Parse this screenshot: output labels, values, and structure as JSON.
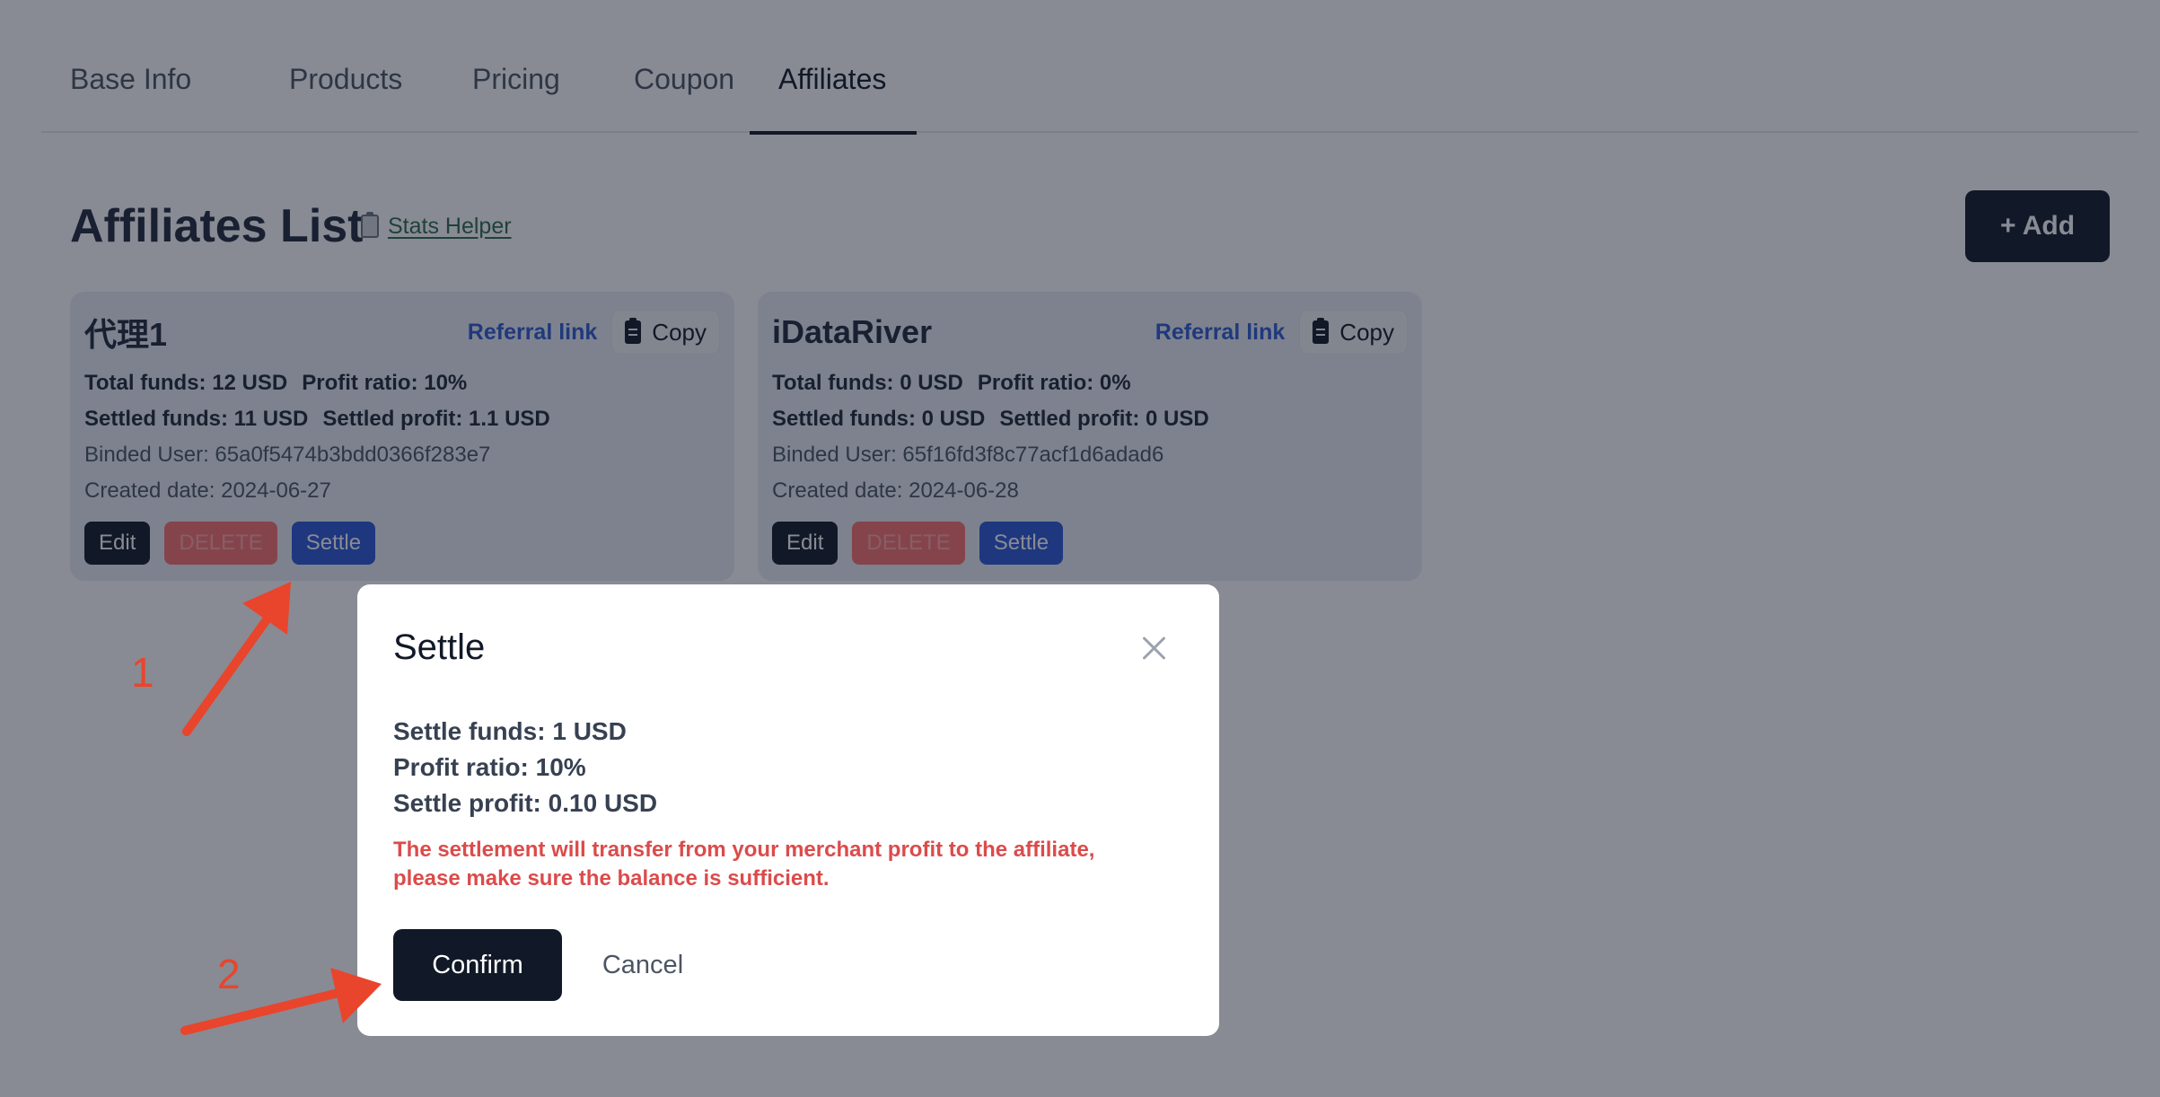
{
  "tabs": [
    {
      "label": "Base Info",
      "active": false
    },
    {
      "label": "Products",
      "active": false
    },
    {
      "label": "Pricing",
      "active": false
    },
    {
      "label": "Coupon",
      "active": false
    },
    {
      "label": "Affiliates",
      "active": true
    }
  ],
  "header": {
    "title": "Affiliates List",
    "stats_helper_icon": "clipboard-icon",
    "stats_helper_label": "Stats Helper",
    "add_button_label": "+ Add"
  },
  "affiliates": [
    {
      "name": "代理1",
      "referral_link_label": "Referral link",
      "copy_label": "Copy",
      "total_funds": "Total funds: 12 USD",
      "profit_ratio": "Profit ratio: 10%",
      "settled_funds": "Settled funds: 11 USD",
      "settled_profit": "Settled profit: 1.1 USD",
      "binded_user": "Binded User: 65a0f5474b3bdd0366f283e7",
      "created_date": "Created date: 2024-06-27",
      "edit_label": "Edit",
      "delete_label": "DELETE",
      "settle_label": "Settle"
    },
    {
      "name": "iDataRiver",
      "referral_link_label": "Referral link",
      "copy_label": "Copy",
      "total_funds": "Total funds: 0 USD",
      "profit_ratio": "Profit ratio: 0%",
      "settled_funds": "Settled funds: 0 USD",
      "settled_profit": "Settled profit: 0 USD",
      "binded_user": "Binded User: 65f16fd3f8c77acf1d6adad6",
      "created_date": "Created date: 2024-06-28",
      "edit_label": "Edit",
      "delete_label": "DELETE",
      "settle_label": "Settle"
    }
  ],
  "modal": {
    "title": "Settle",
    "settle_funds": "Settle funds: 1 USD",
    "profit_ratio": "Profit ratio: 10%",
    "settle_profit": "Settle profit: 0.10 USD",
    "warning": "The settlement will transfer from your merchant profit to the affiliate, please make sure the balance is sufficient.",
    "confirm_label": "Confirm",
    "cancel_label": "Cancel"
  },
  "annotations": {
    "step1": "1",
    "step2": "2",
    "color": "#e8452c"
  },
  "colors": {
    "primary_dark": "#111827",
    "link_blue": "#2d5bd0",
    "settle_blue": "#2c56d6",
    "delete_red": "#f87171",
    "warning_red": "#dc4b4b",
    "stats_link_green": "#2f6b4c"
  }
}
